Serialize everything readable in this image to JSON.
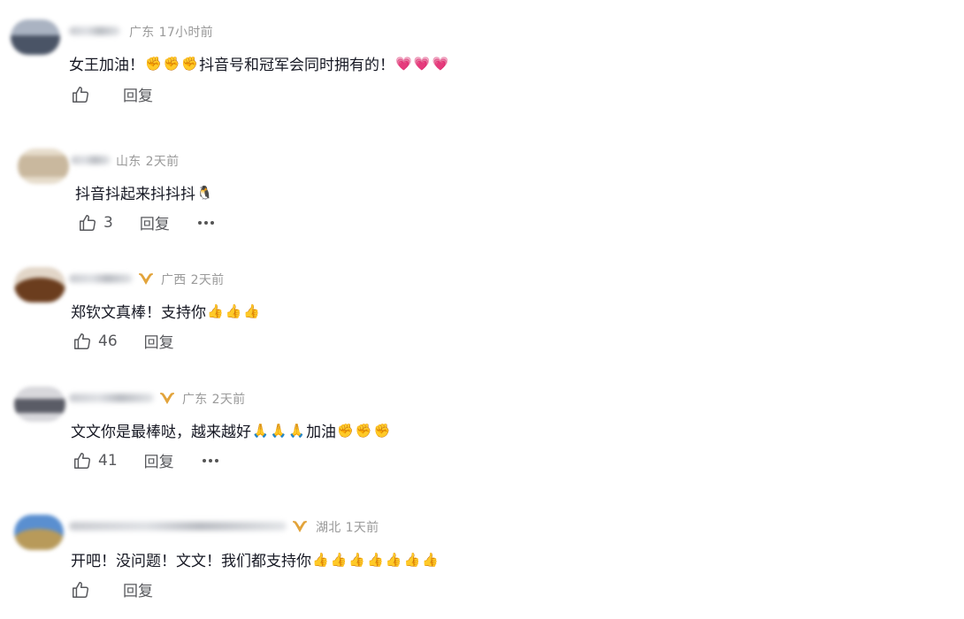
{
  "comments": [
    {
      "region": "广东",
      "time": "17小时前",
      "verified": false,
      "text": "女王加油！",
      "emojis_1": [
        "✊",
        "✊",
        "✊"
      ],
      "text_2": "抖音号和冠军会同时拥有的！",
      "emojis_2": [
        "💗",
        "💗",
        "💗"
      ],
      "like_count": "",
      "reply_label": "回复",
      "has_more": false,
      "avatar_colors": [
        "#4a5466",
        "#aab3c2"
      ]
    },
    {
      "region": "山东",
      "time": "2天前",
      "verified": false,
      "text": "抖音抖起来抖抖抖",
      "emojis_1": [
        "🐧"
      ],
      "text_2": "",
      "emojis_2": [],
      "like_count": "3",
      "reply_label": "回复",
      "has_more": true,
      "avatar_colors": [
        "#c9b89e",
        "#e6dccb"
      ]
    },
    {
      "region": "广西",
      "time": "2天前",
      "verified": true,
      "text": "郑钦文真棒！支持你",
      "emojis_1": [
        "👍",
        "👍",
        "👍"
      ],
      "text_2": "",
      "emojis_2": [],
      "like_count": "46",
      "reply_label": "回复",
      "has_more": false,
      "avatar_colors": [
        "#e2d6c8",
        "#6b3d1e"
      ]
    },
    {
      "region": "广东",
      "time": "2天前",
      "verified": true,
      "text": "文文你是最棒哒，越来越好",
      "emojis_1": [
        "🙏",
        "🙏",
        "🙏"
      ],
      "text_2": "加油",
      "emojis_2": [
        "✊",
        "✊",
        "✊"
      ],
      "like_count": "41",
      "reply_label": "回复",
      "has_more": true,
      "avatar_colors": [
        "#d8d8dc",
        "#5a5c66"
      ]
    },
    {
      "region": "湖北",
      "time": "1天前",
      "verified": true,
      "text": "开吧！没问题！文文！我们都支持你",
      "emojis_1": [
        "👍",
        "👍",
        "👍",
        "👍",
        "👍",
        "👍",
        "👍"
      ],
      "text_2": "",
      "emojis_2": [],
      "like_count": "",
      "reply_label": "回复",
      "has_more": false,
      "avatar_colors": [
        "#5a8fd0",
        "#b89a5a"
      ]
    }
  ],
  "colors": {
    "meta": "#9a9a9a",
    "badge": "#e2a33a",
    "text": "#161823",
    "action": "#57585c"
  }
}
